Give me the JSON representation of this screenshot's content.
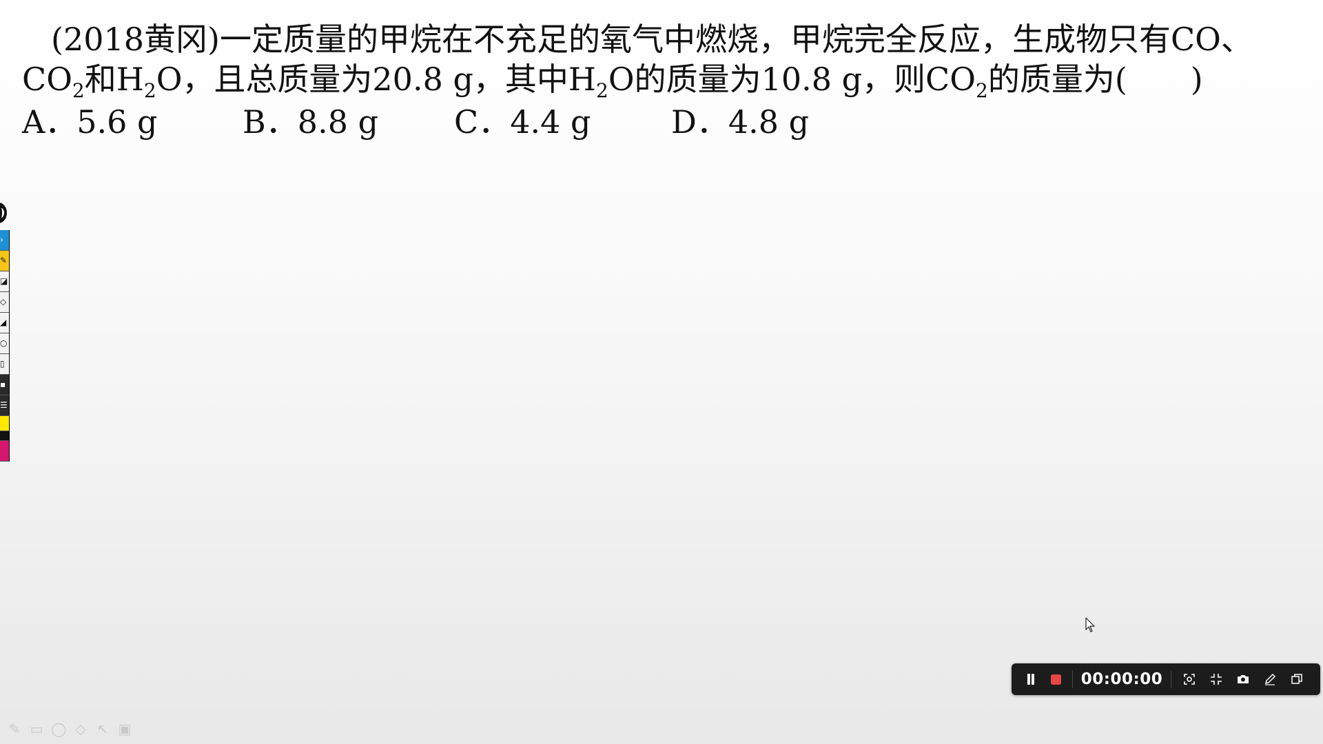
{
  "question": {
    "line1": {
      "prefix": "(2018黄冈)一定质量的甲烷在不充足的氧气中燃烧，甲烷完全反应，生成物只有CO、"
    },
    "line2": {
      "co": "CO",
      "sub1": "2",
      "and_h": "和H",
      "sub2": "2",
      "mid": "O，且总质量为20.8 g，其中H",
      "sub3": "2",
      "mid2": "O的质量为10.8 g，则CO",
      "sub4": "2",
      "end": "的质量为(　　)"
    },
    "options": [
      {
        "text": "A．5.6 g"
      },
      {
        "text": "B．8.8 g"
      },
      {
        "text": "C．4.4 g"
      },
      {
        "text": "D．4.8 g"
      }
    ]
  },
  "left_toolbar": {
    "icons": [
      "arrow-icon",
      "pen-icon",
      "highlighter-icon",
      "eraser-icon",
      "shape-icon",
      "line-icon",
      "circle-icon",
      "trash-icon",
      "settings-icon",
      "list-icon",
      "color-yellow-swatch",
      "color-black-swatch",
      "color-magenta-swatch"
    ],
    "colors": {
      "blue": "#1e90d6",
      "yellow": "#f5c518",
      "black": "#111111",
      "magenta": "#d4176e",
      "bright_yellow": "#ffe800"
    }
  },
  "faint_tools": [
    "pencil-icon",
    "image-icon",
    "lasso-icon",
    "eraser-icon",
    "pointer-icon",
    "camera-icon"
  ],
  "recorder": {
    "timer": "00:00:00",
    "stop_color": "#e84545",
    "icons": [
      "pause-icon",
      "stop-icon",
      "region-icon",
      "shrink-icon",
      "camera-icon",
      "pen-icon",
      "window-icon"
    ]
  }
}
